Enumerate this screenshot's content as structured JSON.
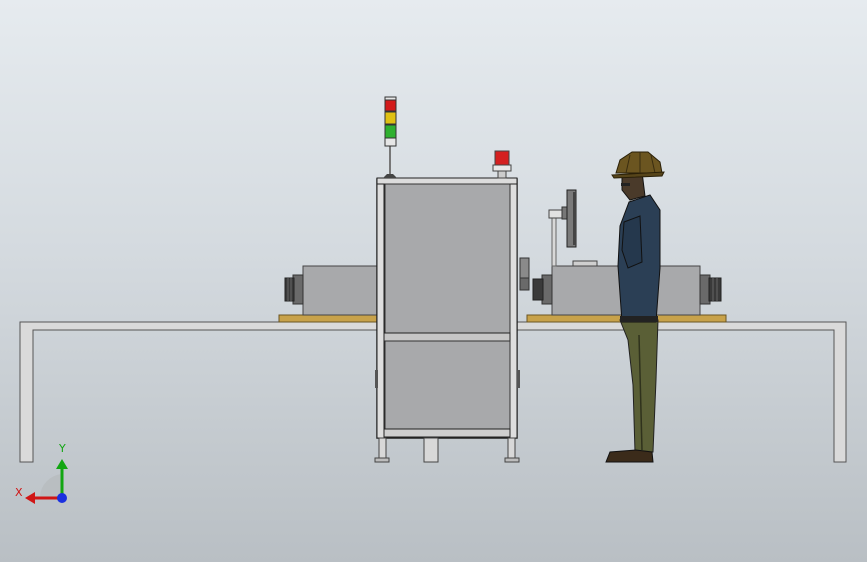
{
  "axes": {
    "x_label": "X",
    "y_label": "Y",
    "x_color": "#d01515",
    "y_color": "#12a612",
    "z_color": "#1a30e0"
  },
  "colors": {
    "background_top": "#e6ebef",
    "background_bottom": "#b9bfc4",
    "machine_body": "#a7a9ab",
    "frame": "#4a4a4a",
    "conveyor_bed": "#c8a24a",
    "stand": "#dadada",
    "worker_shirt": "#2b3f55",
    "worker_pants": "#5a5f36",
    "helmet": "#6b5520"
  },
  "stack_light": {
    "segments": [
      "red",
      "yellow",
      "green"
    ],
    "segment_colors": [
      "#d21a1a",
      "#e0c012",
      "#2fb02f"
    ]
  },
  "beacon_color": "#d42020"
}
